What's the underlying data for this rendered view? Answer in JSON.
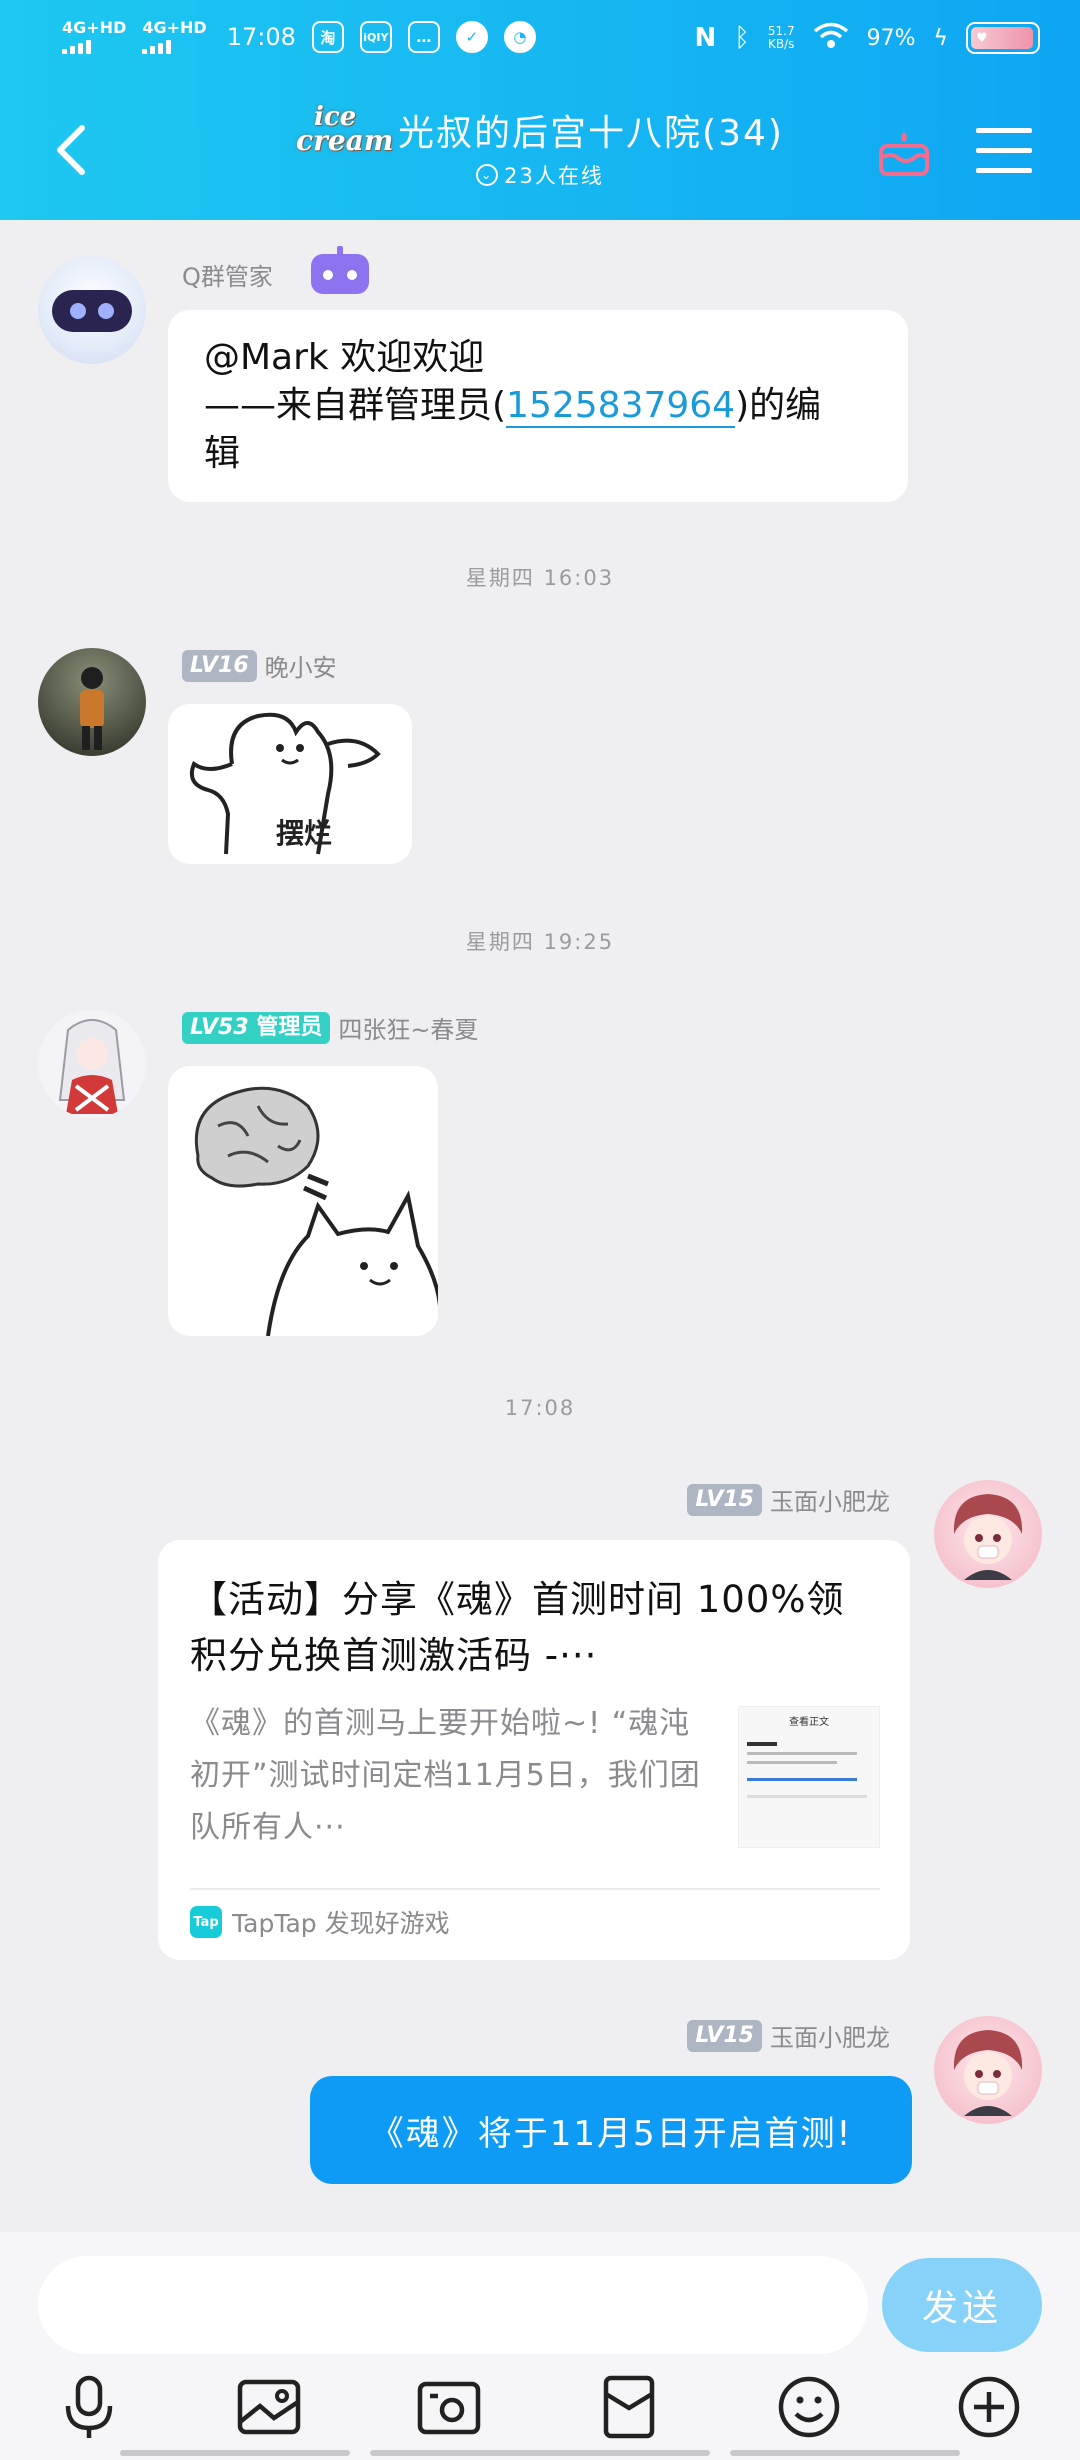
{
  "status_bar": {
    "net1": "4G+HD",
    "net2": "4G+HD",
    "time": "17:08",
    "app_icon_1": "淘",
    "app_icon_2": "iQIY",
    "speed_value": "51.7",
    "speed_unit": "KB/s",
    "battery": "97%",
    "battery_level": 0.97
  },
  "header": {
    "badge_word1": "ice",
    "badge_word2": "cream",
    "title": "光叔的后宫十八院(34)",
    "online": "23人在线"
  },
  "messages": {
    "bot": {
      "name": "Q群管家",
      "line1": "@Mark 欢迎欢迎",
      "line2_pre": "——来自群管理员(",
      "admin_id": "1525837964",
      "line2_post": ")的编",
      "line3": "辑"
    },
    "sep1": "星期四 16:03",
    "msg2": {
      "level": "LV16",
      "name": "晚小安",
      "sticker_text": "摆烂"
    },
    "sep2": "星期四 19:25",
    "msg3": {
      "level": "LV53",
      "role": "管理员",
      "name": "四张狂~春夏"
    },
    "sep3": "17:08",
    "msg4": {
      "level": "LV15",
      "name": "玉面小肥龙",
      "card_title": "【活动】分享《魂》首测时间 100%领积分兑换首测激活码 -···",
      "card_desc": "《魂》的首测马上要开始啦~! “魂沌初开”测试时间定档11月5日，我们团队所有人···",
      "thumb_title": "查看正文",
      "source": "TapTap 发现好游戏",
      "tap_icon": "Tap"
    },
    "msg5": {
      "level": "LV15",
      "name": "玉面小肥龙",
      "text": "《魂》将于11月5日开启首测!"
    }
  },
  "input": {
    "placeholder": "",
    "send_label": "发送"
  },
  "colors": {
    "header_start": "#1ec8f0",
    "header_end": "#0ea6f3",
    "self_bubble": "#0d9bf6",
    "send_button": "#87d2f8",
    "admin_badge": "#33d1c4",
    "level_badge": "#aeb6c4"
  },
  "icons": [
    "back-arrow-icon",
    "cake-icon",
    "menu-icon",
    "mic-icon",
    "image-icon",
    "camera-icon",
    "red-packet-icon",
    "emoji-icon",
    "plus-icon"
  ]
}
